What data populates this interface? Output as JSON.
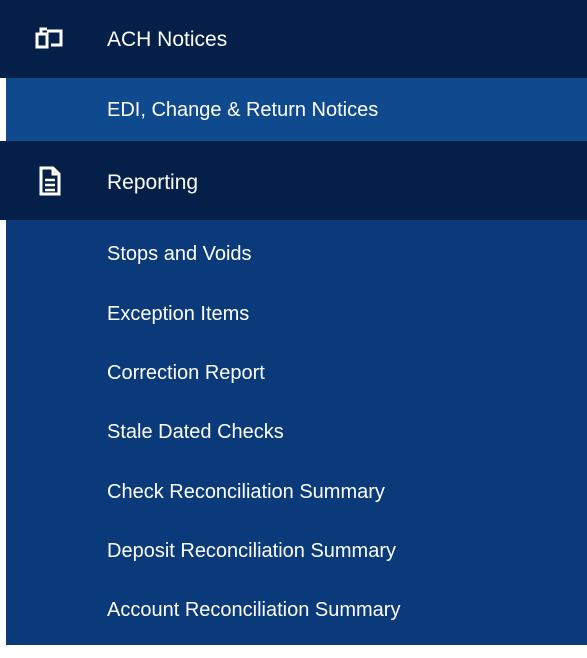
{
  "nav": {
    "sections": [
      {
        "icon": "copy-icon",
        "title": "ACH Notices",
        "items": [
          {
            "label": "EDI, Change & Return Notices",
            "active": true
          }
        ]
      },
      {
        "icon": "document-icon",
        "title": "Reporting",
        "items": [
          {
            "label": "Stops and Voids"
          },
          {
            "label": "Exception Items"
          },
          {
            "label": "Correction Report"
          },
          {
            "label": "Stale Dated Checks"
          },
          {
            "label": "Check Reconciliation Summary"
          },
          {
            "label": "Deposit Reconciliation Summary"
          },
          {
            "label": "Account Reconciliation Summary"
          }
        ]
      }
    ]
  },
  "colors": {
    "header_bg": "#041f48",
    "panel_bg": "#0b3a7b",
    "active_bg": "#0f4a8e",
    "text": "#ffffff"
  }
}
